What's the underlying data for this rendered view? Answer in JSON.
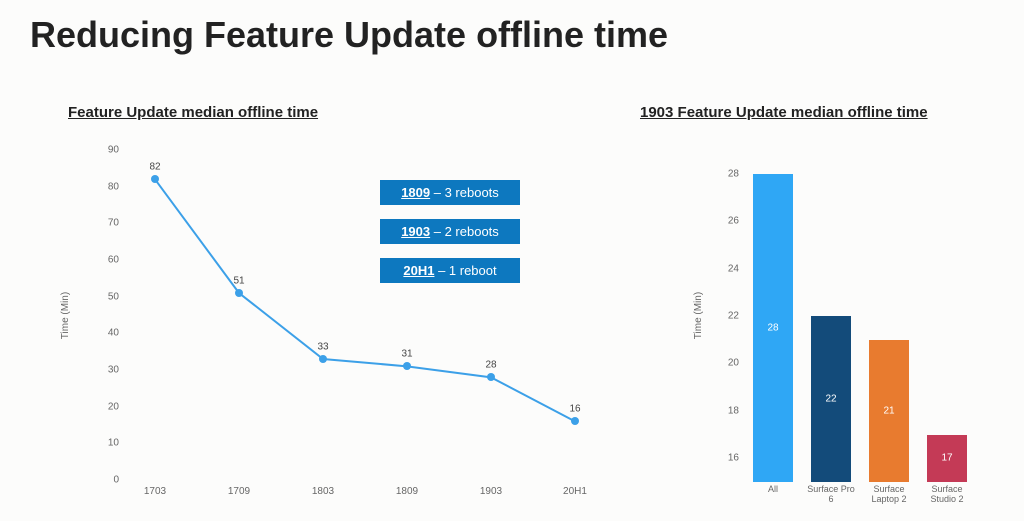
{
  "title": "Reducing Feature Update offline time",
  "left": {
    "subtitle": "Feature Update median offline time",
    "ylabel": "Time (Min)"
  },
  "right": {
    "subtitle": "1903 Feature Update median offline time",
    "ylabel": "Time (Min)"
  },
  "legend": [
    {
      "bold": "1809",
      "rest": " – 3 reboots"
    },
    {
      "bold": "1903",
      "rest": " – 2 reboots"
    },
    {
      "bold": "20H1",
      "rest": " – 1 reboot"
    }
  ],
  "chart_data": [
    {
      "type": "line",
      "title": "Feature Update median offline time",
      "xlabel": "",
      "ylabel": "Time (Min)",
      "ylim": [
        0,
        90
      ],
      "yticks": [
        0,
        10,
        20,
        30,
        40,
        50,
        60,
        70,
        80,
        90
      ],
      "categories": [
        "1703",
        "1709",
        "1803",
        "1809",
        "1903",
        "20H1"
      ],
      "values": [
        82,
        51,
        33,
        31,
        28,
        16
      ],
      "color": "#3ca0e8"
    },
    {
      "type": "bar",
      "title": "1903 Feature Update median offline time",
      "xlabel": "",
      "ylabel": "Time (Min)",
      "ylim": [
        15,
        29
      ],
      "yticks": [
        16,
        18,
        20,
        22,
        24,
        26,
        28
      ],
      "categories": [
        "All",
        "Surface Pro 6",
        "Surface Laptop 2",
        "Surface Studio 2"
      ],
      "values": [
        28,
        22,
        21,
        17
      ],
      "colors": [
        "#2fa7f5",
        "#134b7a",
        "#e87b2f",
        "#c43a56"
      ]
    }
  ]
}
